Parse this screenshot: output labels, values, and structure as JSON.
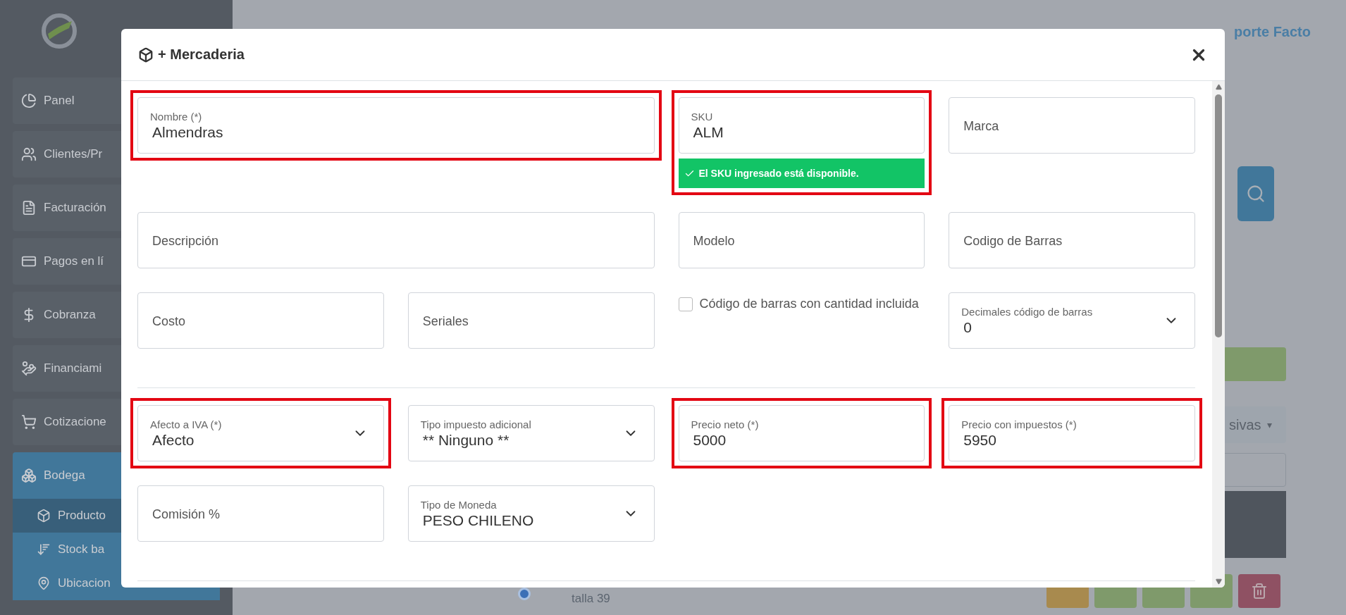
{
  "sidebar": {
    "items": [
      {
        "label": "Panel",
        "selected": false
      },
      {
        "label": "Clientes/Pr",
        "selected": false
      },
      {
        "label": "Facturación",
        "selected": false
      },
      {
        "label": "Pagos en lí",
        "selected": false
      },
      {
        "label": "Cobranza",
        "selected": false
      },
      {
        "label": "Financiami",
        "selected": false
      },
      {
        "label": "Cotizacione",
        "selected": false
      },
      {
        "label": "Bodega",
        "selected": true,
        "children": [
          {
            "label": "Producto",
            "selected": true
          },
          {
            "label": "Stock ba",
            "selected": false
          },
          {
            "label": "Ubicacion",
            "selected": false
          }
        ]
      }
    ]
  },
  "topbar": {
    "user_name": "porte Facto"
  },
  "background": {
    "filter_label": "sivas",
    "filter_caret": "▾",
    "row_selected": true,
    "row_text": "talla 39"
  },
  "modal": {
    "title": "+ Mercaderia",
    "sections": [
      {
        "rows": [
          [
            {
              "kind": "text",
              "label": "Nombre (*)",
              "value": "Almendras",
              "colspan": 2,
              "highlighted": true
            },
            {
              "kind": "text",
              "label": "SKU",
              "value": "ALM",
              "highlighted": true,
              "status": "El SKU ingresado está disponible."
            },
            {
              "kind": "text",
              "placeholder": "Marca",
              "highlighted": false
            }
          ],
          [
            {
              "kind": "text",
              "placeholder": "Descripción",
              "colspan": 2,
              "highlighted": false
            },
            {
              "kind": "text",
              "placeholder": "Modelo",
              "highlighted": false
            },
            {
              "kind": "text",
              "placeholder": "Codigo de Barras",
              "highlighted": false
            }
          ],
          [
            {
              "kind": "text",
              "placeholder": "Costo",
              "highlighted": false
            },
            {
              "kind": "text",
              "placeholder": "Seriales",
              "highlighted": false
            },
            {
              "kind": "checkbox",
              "label": "Código de barras con cantidad incluida",
              "checked": false
            },
            {
              "kind": "select",
              "label": "Decimales código de barras",
              "value": "0",
              "highlighted": false
            }
          ]
        ]
      },
      {
        "rows": [
          [
            {
              "kind": "select",
              "label": "Afecto a IVA (*)",
              "value": "Afecto",
              "highlighted": true
            },
            {
              "kind": "select",
              "label": "Tipo impuesto adicional",
              "value": "** Ninguno **",
              "highlighted": false
            },
            {
              "kind": "text",
              "label": "Precio neto (*)",
              "value": "5000",
              "highlighted": true
            },
            {
              "kind": "text",
              "label": "Precio con impuestos (*)",
              "value": "5950",
              "highlighted": true
            }
          ],
          [
            {
              "kind": "text",
              "placeholder": "Comisión %",
              "highlighted": false
            },
            {
              "kind": "select",
              "label": "Tipo de Moneda",
              "value": "PESO CHILENO",
              "highlighted": false
            }
          ]
        ]
      }
    ]
  }
}
